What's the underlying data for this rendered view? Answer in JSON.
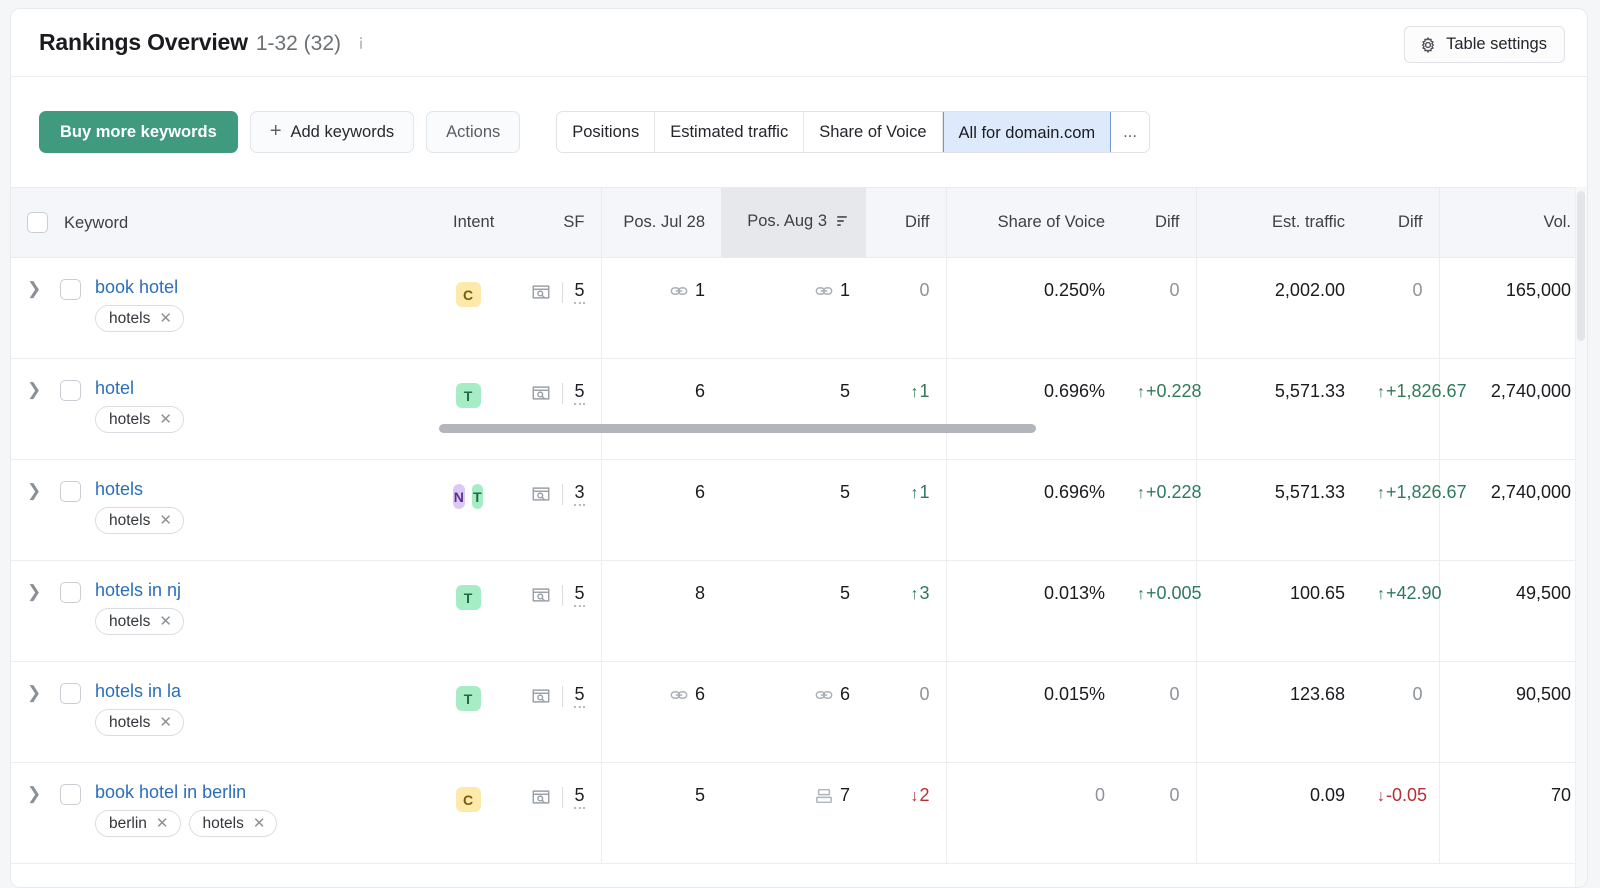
{
  "header": {
    "title": "Rankings Overview",
    "count_label": "1-32 (32)",
    "info_icon": "info-icon",
    "table_settings_label": "Table settings",
    "gear_icon": "gear-icon"
  },
  "toolbar": {
    "buy_keywords_label": "Buy more keywords",
    "add_keywords_label": "Add keywords",
    "add_icon": "plus-icon",
    "actions_label": "Actions",
    "segments": [
      {
        "label": "Positions",
        "active": false
      },
      {
        "label": "Estimated traffic",
        "active": false
      },
      {
        "label": "Share of Voice",
        "active": false
      },
      {
        "label": "All for domain.com",
        "active": true
      },
      {
        "label": "...",
        "active": false
      }
    ]
  },
  "table": {
    "columns": [
      {
        "key": "keyword",
        "label": "Keyword",
        "align": "left"
      },
      {
        "key": "intent",
        "label": "Intent",
        "align": "center"
      },
      {
        "key": "sf",
        "label": "SF",
        "align": "right"
      },
      {
        "key": "pos_jul28",
        "label": "Pos. Jul 28",
        "align": "right"
      },
      {
        "key": "pos_aug3",
        "label": "Pos. Aug 3",
        "align": "right",
        "sorted": true,
        "sort_icon": "sort-descending-icon"
      },
      {
        "key": "pos_diff",
        "label": "Diff",
        "align": "right"
      },
      {
        "key": "sov",
        "label": "Share of Voice",
        "align": "right"
      },
      {
        "key": "sov_diff",
        "label": "Diff",
        "align": "right"
      },
      {
        "key": "traffic",
        "label": "Est. traffic",
        "align": "right"
      },
      {
        "key": "traf_diff",
        "label": "Diff",
        "align": "right"
      },
      {
        "key": "vol",
        "label": "Vol.",
        "align": "right"
      }
    ],
    "rows": [
      {
        "keyword": "book hotel",
        "tags": [
          "hotels"
        ],
        "intent": [
          "C"
        ],
        "sf": "5",
        "pos_jul28": "1",
        "pos_jul28_icon": "link-icon",
        "pos_aug3": "1",
        "pos_aug3_icon": "link-icon",
        "pos_diff": "0",
        "pos_diff_dir": "none",
        "sov": "0.250%",
        "sov_diff": "0",
        "sov_diff_dir": "none",
        "traffic": "2,002.00",
        "traf_diff": "0",
        "traf_diff_dir": "none",
        "vol": "165,000"
      },
      {
        "keyword": "hotel",
        "tags": [
          "hotels"
        ],
        "intent": [
          "T"
        ],
        "sf": "5",
        "pos_jul28": "6",
        "pos_jul28_icon": "",
        "pos_aug3": "5",
        "pos_aug3_icon": "",
        "pos_diff": "1",
        "pos_diff_dir": "up",
        "sov": "0.696%",
        "sov_diff": "+0.228",
        "sov_diff_dir": "up",
        "traffic": "5,571.33",
        "traf_diff": "+1,826.67",
        "traf_diff_dir": "up",
        "vol": "2,740,000"
      },
      {
        "keyword": "hotels",
        "tags": [
          "hotels"
        ],
        "intent": [
          "N",
          "T"
        ],
        "sf": "3",
        "pos_jul28": "6",
        "pos_jul28_icon": "",
        "pos_aug3": "5",
        "pos_aug3_icon": "",
        "pos_diff": "1",
        "pos_diff_dir": "up",
        "sov": "0.696%",
        "sov_diff": "+0.228",
        "sov_diff_dir": "up",
        "traffic": "5,571.33",
        "traf_diff": "+1,826.67",
        "traf_diff_dir": "up",
        "vol": "2,740,000"
      },
      {
        "keyword": "hotels in nj",
        "tags": [
          "hotels"
        ],
        "intent": [
          "T"
        ],
        "sf": "5",
        "pos_jul28": "8",
        "pos_jul28_icon": "",
        "pos_aug3": "5",
        "pos_aug3_icon": "",
        "pos_diff": "3",
        "pos_diff_dir": "up",
        "sov": "0.013%",
        "sov_diff": "+0.005",
        "sov_diff_dir": "up",
        "traffic": "100.65",
        "traf_diff": "+42.90",
        "traf_diff_dir": "up",
        "vol": "49,500"
      },
      {
        "keyword": "hotels in la",
        "tags": [
          "hotels"
        ],
        "intent": [
          "T"
        ],
        "sf": "5",
        "pos_jul28": "6",
        "pos_jul28_icon": "link-icon",
        "pos_aug3": "6",
        "pos_aug3_icon": "link-icon",
        "pos_diff": "0",
        "pos_diff_dir": "none",
        "sov": "0.015%",
        "sov_diff": "0",
        "sov_diff_dir": "none",
        "traffic": "123.68",
        "traf_diff": "0",
        "traf_diff_dir": "none",
        "vol": "90,500"
      },
      {
        "keyword": "book hotel in berlin",
        "tags": [
          "berlin",
          "hotels"
        ],
        "intent": [
          "C"
        ],
        "sf": "5",
        "pos_jul28": "5",
        "pos_jul28_icon": "",
        "pos_aug3": "7",
        "pos_aug3_icon": "carousel-icon",
        "pos_diff": "2",
        "pos_diff_dir": "down",
        "sov": "0",
        "sov_diff": "0",
        "sov_diff_dir": "none",
        "traffic": "0.09",
        "traf_diff": "-0.05",
        "traf_diff_dir": "down",
        "vol": "70"
      }
    ]
  },
  "colors": {
    "primary_green": "#3f9a7e",
    "positive": "#2f7a5b",
    "negative": "#bb2d33",
    "link": "#2a6ebb",
    "active_segment_bg": "#ddeafb",
    "badge_commercial": "#fde9a9",
    "badge_transactional": "#a6ecc4",
    "badge_navigational": "#dcc8f6"
  }
}
